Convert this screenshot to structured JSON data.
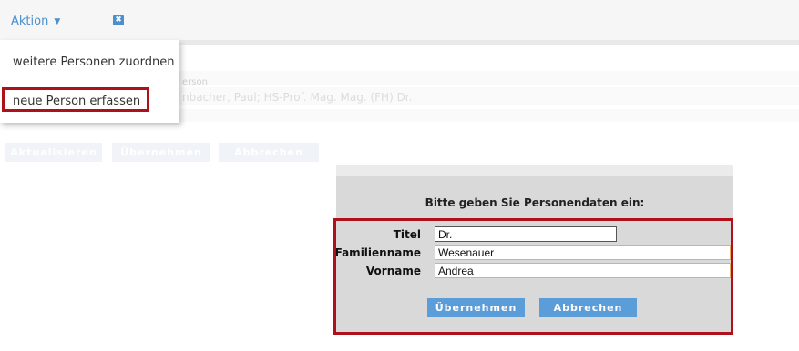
{
  "toolbar": {
    "aktion_label": "Aktion",
    "caret": "▼",
    "close_glyph": "✖"
  },
  "background_form": {
    "field_label": "erson",
    "field_value": "nbacher, Paul; HS-Prof. Mag. Mag. (FH) Dr.",
    "btn_aktualisieren": "Aktualisieren",
    "btn_uebernehmen": "Übernehmen",
    "btn_abbrechen": "Abbrechen"
  },
  "menu": {
    "items": [
      {
        "label": "weitere Personen zuordnen"
      },
      {
        "label": "neue Person erfassen"
      }
    ]
  },
  "dialog": {
    "title": "Bitte geben Sie Personendaten ein:",
    "fields": {
      "titel": {
        "label": "Titel",
        "value": "Dr."
      },
      "familienname": {
        "label": "Familienname",
        "value": "Wesenauer"
      },
      "vorname": {
        "label": "Vorname",
        "value": "Andrea"
      }
    },
    "btn_uebernehmen": "Übernehmen",
    "btn_abbrechen": "Abbrechen"
  },
  "colors": {
    "accent": "#4a8fce",
    "highlight": "#b0101a",
    "button": "#5b9dd9"
  }
}
